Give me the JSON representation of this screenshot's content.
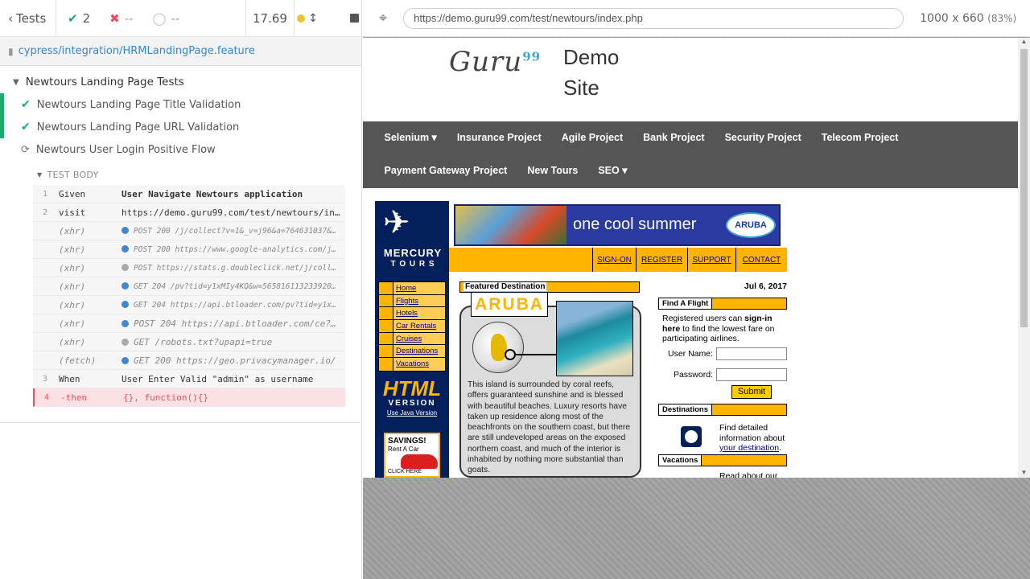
{
  "topbar": {
    "tests_label": "Tests",
    "passed": "2",
    "failed": "--",
    "pending": "--",
    "duration": "17.69"
  },
  "spec": {
    "file": "cypress/integration/HRMLandingPage.feature"
  },
  "reporter": {
    "suite_title": "Newtours Landing Page Tests",
    "tests": [
      {
        "title": "Newtours Landing Page Title Validation",
        "state": "passed"
      },
      {
        "title": "Newtours Landing Page URL Validation",
        "state": "passed"
      },
      {
        "title": "Newtours User Login Positive Flow",
        "state": "running"
      }
    ],
    "body_label": "TEST BODY",
    "commands": [
      {
        "num": "1",
        "name": "Given",
        "msg": "User Navigate Newtours application"
      },
      {
        "num": "2",
        "name": "visit",
        "msg": "https://demo.guru99.com/test/newtours/in…"
      },
      {
        "num": "",
        "name": "(xhr)",
        "msg": "POST 200 /j/collect?v=1&_v=j96&a=764631037&t…"
      },
      {
        "num": "",
        "name": "(xhr)",
        "msg": "POST 200 https://www.google-analytics.com/j/…"
      },
      {
        "num": "",
        "name": "(xhr)",
        "msg": "POST https://stats.g.doubleclick.net/j/colle…"
      },
      {
        "num": "",
        "name": "(xhr)",
        "msg": "GET 204 /pv?tid=y1xMIy4KQ&w=5658161132339200…"
      },
      {
        "num": "",
        "name": "(xhr)",
        "msg": "GET 204 https://api.btloader.com/pv?tid=y1xM…"
      },
      {
        "num": "",
        "name": "(xhr)",
        "msg": "POST 204 https://api.btloader.com/ce?…"
      },
      {
        "num": "",
        "name": "(xhr)",
        "msg": "GET /robots.txt?upapi=true"
      },
      {
        "num": "",
        "name": "(fetch)",
        "msg": "GET 200 https://geo.privacymanager.io/"
      },
      {
        "num": "3",
        "name": "When",
        "msg": "User Enter Valid \"admin\" as username"
      },
      {
        "num": "4",
        "name": "-then",
        "msg": "{}, function(){}"
      }
    ]
  },
  "aut": {
    "url": "https://demo.guru99.com/test/newtours/index.php",
    "viewport": "1000 x 660",
    "scale": "(83%)"
  },
  "site": {
    "logo": "Guru",
    "logo_sup": "99",
    "title": "Demo Site",
    "nav": [
      "Selenium ▾",
      "Insurance Project",
      "Agile Project",
      "Bank Project",
      "Security Project",
      "Telecom Project",
      "Payment Gateway Project",
      "New Tours",
      "SEO ▾"
    ]
  },
  "mercury": {
    "logo_line1": "MERCURY",
    "logo_line2": "T O U R S",
    "menu": [
      "Home",
      "Flights",
      "Hotels",
      "Car Rentals",
      "Cruises",
      "Destinations",
      "Vacations"
    ],
    "html_big": "HTML",
    "html_version": "VERSION",
    "java_link": "Use Java Version",
    "ad_title": "SAVINGS!",
    "ad_sub": "Rent A Car",
    "ad_cta": "CLICK HERE",
    "banner_text": "one cool summer",
    "banner_brand": "ARUBA",
    "topnav": [
      "SIGN-ON",
      "REGISTER",
      "SUPPORT",
      "CONTACT"
    ],
    "featured_header": "Featured Destination",
    "featured_name": "ARUBA",
    "featured_desc": "This island is surrounded by coral reefs, offers guaranteed sunshine and is blessed with beautiful beaches. Luxury resorts have taken up residence along most of the beachfronts on the southern coast, but there are still undeveloped areas on the exposed northern coast, and much of the interior is inhabited by nothing more substantial than goats.",
    "date": "Jul 6, 2017",
    "find_flight": "Find A Flight",
    "reg_text_1": "Registered users can ",
    "reg_text_bold": "sign-in here",
    "reg_text_2": " to find the lowest fare on participating airlines.",
    "user_label": "User Name:",
    "pass_label": "Password:",
    "submit": "Submit",
    "destinations": "Destinations",
    "dest_text": "Find detailed information about ",
    "dest_link": "your destination",
    "vacations": "Vacations",
    "vac_text": "Read about our"
  }
}
